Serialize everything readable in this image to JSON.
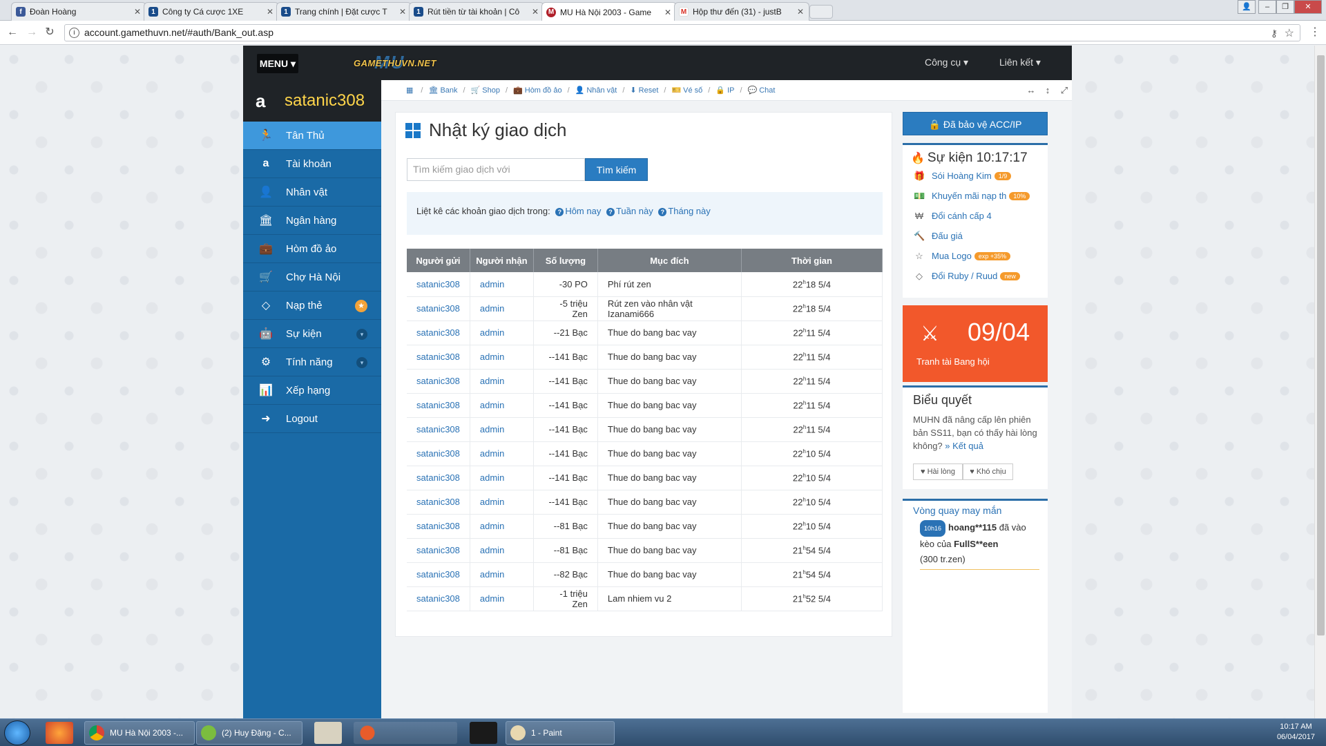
{
  "browser": {
    "tabs": [
      {
        "title": "Đoàn Hoàng",
        "favicon": "facebook-icon",
        "color": "#3b5998",
        "glyph": "f"
      },
      {
        "title": "Công ty Cá cược 1XE",
        "favicon": "1xbet-icon",
        "color": "#1a4c8a",
        "glyph": "1"
      },
      {
        "title": "Trang chính | Đặt cược T",
        "favicon": "1xbet-icon",
        "color": "#1a4c8a",
        "glyph": "1"
      },
      {
        "title": "Rút tiền từ tài khoản | Cô",
        "favicon": "1xbet-icon",
        "color": "#1a4c8a",
        "glyph": "1"
      },
      {
        "title": "MU Hà Nội 2003 - Game",
        "favicon": "mu-icon",
        "color": "#b0202a",
        "glyph": "M"
      },
      {
        "title": "Hộp thư đến (31) - justB",
        "favicon": "gmail-icon",
        "color": "#d93025",
        "glyph": "M"
      }
    ],
    "url": "account.gamethuvn.net/#auth/Bank_out.asp"
  },
  "site": {
    "menu_label": "MENU ▾",
    "logo_back": "MU",
    "logo_front": "GAMETHUVN.NET",
    "top_links": [
      "Công cụ ▾",
      "Liên kết ▾"
    ],
    "username": "satanic308",
    "sidebar": [
      {
        "label": "Tân Thủ",
        "icon": "running-man-icon",
        "glyph": "🏃"
      },
      {
        "label": "Tài khoản",
        "icon": "amazon-icon",
        "glyph": "a"
      },
      {
        "label": "Nhân vật",
        "icon": "user-icon",
        "glyph": "👤"
      },
      {
        "label": "Ngân hàng",
        "icon": "bank-icon",
        "glyph": "🏛"
      },
      {
        "label": "Hòm đồ ảo",
        "icon": "briefcase-icon",
        "glyph": "💼"
      },
      {
        "label": "Chợ Hà Nội",
        "icon": "cart-icon",
        "glyph": "🛒"
      },
      {
        "label": "Nạp thẻ",
        "icon": "diamond-icon",
        "glyph": "◇"
      },
      {
        "label": "Sự kiện",
        "icon": "android-icon",
        "glyph": "🤖"
      },
      {
        "label": "Tính năng",
        "icon": "cogs-icon",
        "glyph": "⚙"
      },
      {
        "label": "Xếp hạng",
        "icon": "bar-chart-icon",
        "glyph": "📊"
      },
      {
        "label": "Logout",
        "icon": "sign-out-icon",
        "glyph": "➜"
      }
    ],
    "breadcrumb": [
      {
        "label": "",
        "icon": "calendar-icon",
        "glyph": "▦"
      },
      {
        "label": "Bank",
        "icon": "bank-icon",
        "glyph": "🏛"
      },
      {
        "label": "Shop",
        "icon": "cart-icon",
        "glyph": "🛒"
      },
      {
        "label": "Hòm đồ ảo",
        "icon": "briefcase-icon",
        "glyph": "💼"
      },
      {
        "label": "Nhân vật",
        "icon": "user-icon",
        "glyph": "👤"
      },
      {
        "label": "Reset",
        "icon": "download-icon",
        "glyph": "⬇"
      },
      {
        "label": "Vé số",
        "icon": "ticket-icon",
        "glyph": "🎫"
      },
      {
        "label": "IP",
        "icon": "lock-icon",
        "glyph": "🔒"
      },
      {
        "label": "Chat",
        "icon": "comment-icon",
        "glyph": "💬"
      }
    ],
    "panel": {
      "title": "Nhật ký giao dịch",
      "search_placeholder": "Tìm kiếm giao dịch với",
      "search_button": "Tìm kiếm",
      "filter_prefix": "Liệt kê các khoản giao dịch trong:",
      "filter_options": [
        "Hôm nay",
        "Tuần này",
        "Tháng này"
      ]
    },
    "table": {
      "headers": [
        "Người gửi",
        "Người nhận",
        "Số lượng",
        "Mục đích",
        "Thời gian"
      ],
      "rows": [
        {
          "sender": "satanic308",
          "receiver": "admin",
          "amount": "-30  PO",
          "purpose": "Phí rút zen",
          "h": "22",
          "m": "18 5/4"
        },
        {
          "sender": "satanic308",
          "receiver": "admin",
          "amount": "-5  triệu Zen",
          "purpose": "Rút zen vào nhân vật Izanami666",
          "h": "22",
          "m": "18 5/4"
        },
        {
          "sender": "satanic308",
          "receiver": "admin",
          "amount": "--21  Bạc",
          "purpose": "Thue do bang bac vay",
          "h": "22",
          "m": "11 5/4"
        },
        {
          "sender": "satanic308",
          "receiver": "admin",
          "amount": "--141  Bạc",
          "purpose": "Thue do bang bac vay",
          "h": "22",
          "m": "11 5/4"
        },
        {
          "sender": "satanic308",
          "receiver": "admin",
          "amount": "--141  Bạc",
          "purpose": "Thue do bang bac vay",
          "h": "22",
          "m": "11 5/4"
        },
        {
          "sender": "satanic308",
          "receiver": "admin",
          "amount": "--141  Bạc",
          "purpose": "Thue do bang bac vay",
          "h": "22",
          "m": "11 5/4"
        },
        {
          "sender": "satanic308",
          "receiver": "admin",
          "amount": "--141  Bạc",
          "purpose": "Thue do bang bac vay",
          "h": "22",
          "m": "11 5/4"
        },
        {
          "sender": "satanic308",
          "receiver": "admin",
          "amount": "--141  Bạc",
          "purpose": "Thue do bang bac vay",
          "h": "22",
          "m": "10 5/4"
        },
        {
          "sender": "satanic308",
          "receiver": "admin",
          "amount": "--141  Bạc",
          "purpose": "Thue do bang bac vay",
          "h": "22",
          "m": "10 5/4"
        },
        {
          "sender": "satanic308",
          "receiver": "admin",
          "amount": "--141  Bạc",
          "purpose": "Thue do bang bac vay",
          "h": "22",
          "m": "10 5/4"
        },
        {
          "sender": "satanic308",
          "receiver": "admin",
          "amount": "--81  Bạc",
          "purpose": "Thue do bang bac vay",
          "h": "22",
          "m": "10 5/4"
        },
        {
          "sender": "satanic308",
          "receiver": "admin",
          "amount": "--81  Bạc",
          "purpose": "Thue do bang bac vay",
          "h": "21",
          "m": "54 5/4"
        },
        {
          "sender": "satanic308",
          "receiver": "admin",
          "amount": "--82  Bạc",
          "purpose": "Thue do bang bac vay",
          "h": "21",
          "m": "54 5/4"
        },
        {
          "sender": "satanic308",
          "receiver": "admin",
          "amount": "-1  triệu Zen",
          "purpose": "Lam nhiem vu 2",
          "h": "21",
          "m": "52 5/4"
        }
      ]
    },
    "right": {
      "protect_button": "Đã bảo vệ ACC/IP",
      "events_title": "Sự kiện 10:17:17",
      "events": [
        {
          "label": "Sói Hoàng Kim",
          "badge": "1/9",
          "icon": "gift-icon",
          "glyph": "🎁"
        },
        {
          "label": "Khuyến mãi nạp th",
          "badge": "10%",
          "icon": "money-icon",
          "glyph": "💵"
        },
        {
          "label": "Đổi cánh cấp 4",
          "badge": "",
          "icon": "won-icon",
          "glyph": "₩"
        },
        {
          "label": "Đấu giá",
          "badge": "",
          "icon": "gavel-icon",
          "glyph": "🔨"
        },
        {
          "label": "Mua Logo",
          "badge": "exp +35%",
          "icon": "star-icon",
          "glyph": "☆"
        },
        {
          "label": "Đổi Ruby / Ruud",
          "badge": "new",
          "icon": "diamond-icon",
          "glyph": "◇"
        }
      ],
      "countdown_date": "09/04",
      "countdown_label": "Tranh tài Bang hội",
      "vote_title": "Biểu quyết",
      "vote_question": "MUHN đã nâng cấp lên phiên bản SS11, bạn có thấy hài lòng không?",
      "vote_result_link": "» Kết quả",
      "vote_options": [
        "♥ Hài lòng",
        "♥ Khó chịu"
      ],
      "lucky_title": "Vòng quay may mắn",
      "lucky_time": "10h16",
      "lucky_user": "hoang**115",
      "lucky_mid": " đã vào kèo của ",
      "lucky_target": "FullS**een",
      "lucky_tail": "(300 tr.zen)"
    }
  },
  "taskbar": {
    "apps": [
      "MU Hà Nội 2003 -...",
      "(2) Huy Đặng - C...",
      "1 - Paint"
    ],
    "time": "10:17 AM",
    "date": "06/04/2017"
  }
}
